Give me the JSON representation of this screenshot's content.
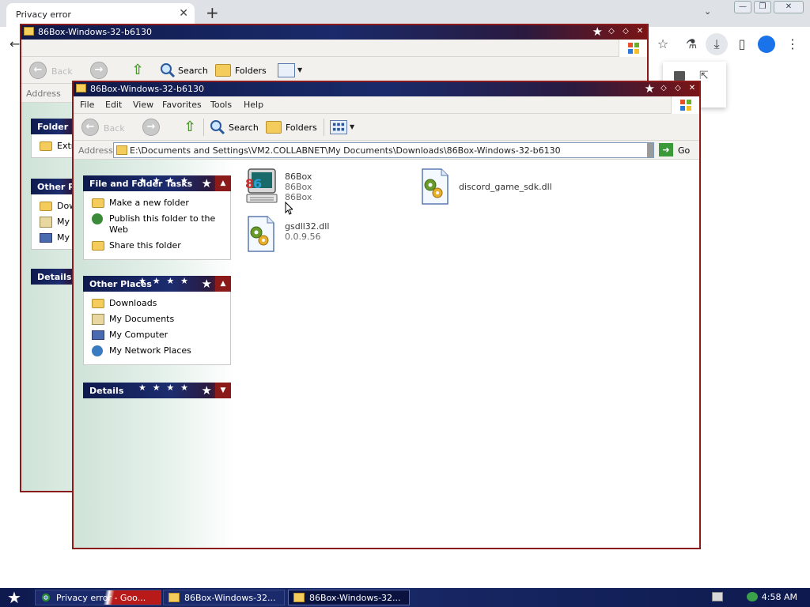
{
  "chrome": {
    "tab_title": "Privacy error",
    "tab_close": "✕",
    "new_tab": "+",
    "tab_search": "⌄",
    "back": "←",
    "window_min": "—",
    "window_max": "❐",
    "window_close": "✕",
    "toolbar_icons": [
      "bookmark-star-icon",
      "labs-flask-icon",
      "download-icon",
      "side-panel-icon",
      "profile-icon",
      "menu-dots-icon"
    ]
  },
  "bg_window": {
    "title": "86Box-Windows-32-b6130",
    "toolbar": {
      "back": "Back",
      "search": "Search",
      "folders": "Folders"
    },
    "address_label": "Address",
    "task_headers": [
      "Folder",
      "Other P",
      "Details"
    ],
    "folder_items": [
      "Extr"
    ],
    "other_items": [
      "Dow",
      "My",
      "My"
    ]
  },
  "window": {
    "title": "86Box-Windows-32-b6130",
    "menu": [
      "File",
      "Edit",
      "View",
      "Favorites",
      "Tools",
      "Help"
    ],
    "toolbar": {
      "back": "Back",
      "search": "Search",
      "folders": "Folders"
    },
    "address_label": "Address",
    "address_path": "E:\\Documents and Settings\\VM2.COLLABNET\\My Documents\\Downloads\\86Box-Windows-32-b6130",
    "go_label": "Go",
    "task_panes": {
      "file_folder_tasks": {
        "title": "File and Folder Tasks",
        "items": [
          {
            "label": "Make a new folder",
            "icon": "new-folder-icon"
          },
          {
            "label": "Publish this folder to the Web",
            "icon": "publish-web-icon"
          },
          {
            "label": "Share this folder",
            "icon": "share-folder-icon"
          }
        ]
      },
      "other_places": {
        "title": "Other Places",
        "items": [
          {
            "label": "Downloads",
            "icon": "folder-icon"
          },
          {
            "label": "My Documents",
            "icon": "my-documents-icon"
          },
          {
            "label": "My Computer",
            "icon": "my-computer-icon"
          },
          {
            "label": "My Network Places",
            "icon": "network-places-icon"
          }
        ]
      },
      "details": {
        "title": "Details"
      }
    },
    "files": [
      {
        "name": "86Box",
        "line2": "86Box",
        "line3": "86Box",
        "icon": "86box-app-icon"
      },
      {
        "name": "discord_game_sdk.dll",
        "icon": "dll-icon"
      },
      {
        "name": "gsdll32.dll",
        "line2": "0.0.9.56",
        "icon": "dll-icon"
      }
    ]
  },
  "taskbar": {
    "buttons": [
      {
        "label": "Privacy error - Goo...",
        "icon": "chrome-icon"
      },
      {
        "label": "86Box-Windows-32...",
        "icon": "folder-icon"
      },
      {
        "label": "86Box-Windows-32...",
        "icon": "folder-icon"
      }
    ],
    "clock": "4:58 AM"
  },
  "colors": {
    "theme_navy": "#0e1a4e",
    "theme_red": "#8b1a1a",
    "dll_gear": "#6a9a2a"
  }
}
